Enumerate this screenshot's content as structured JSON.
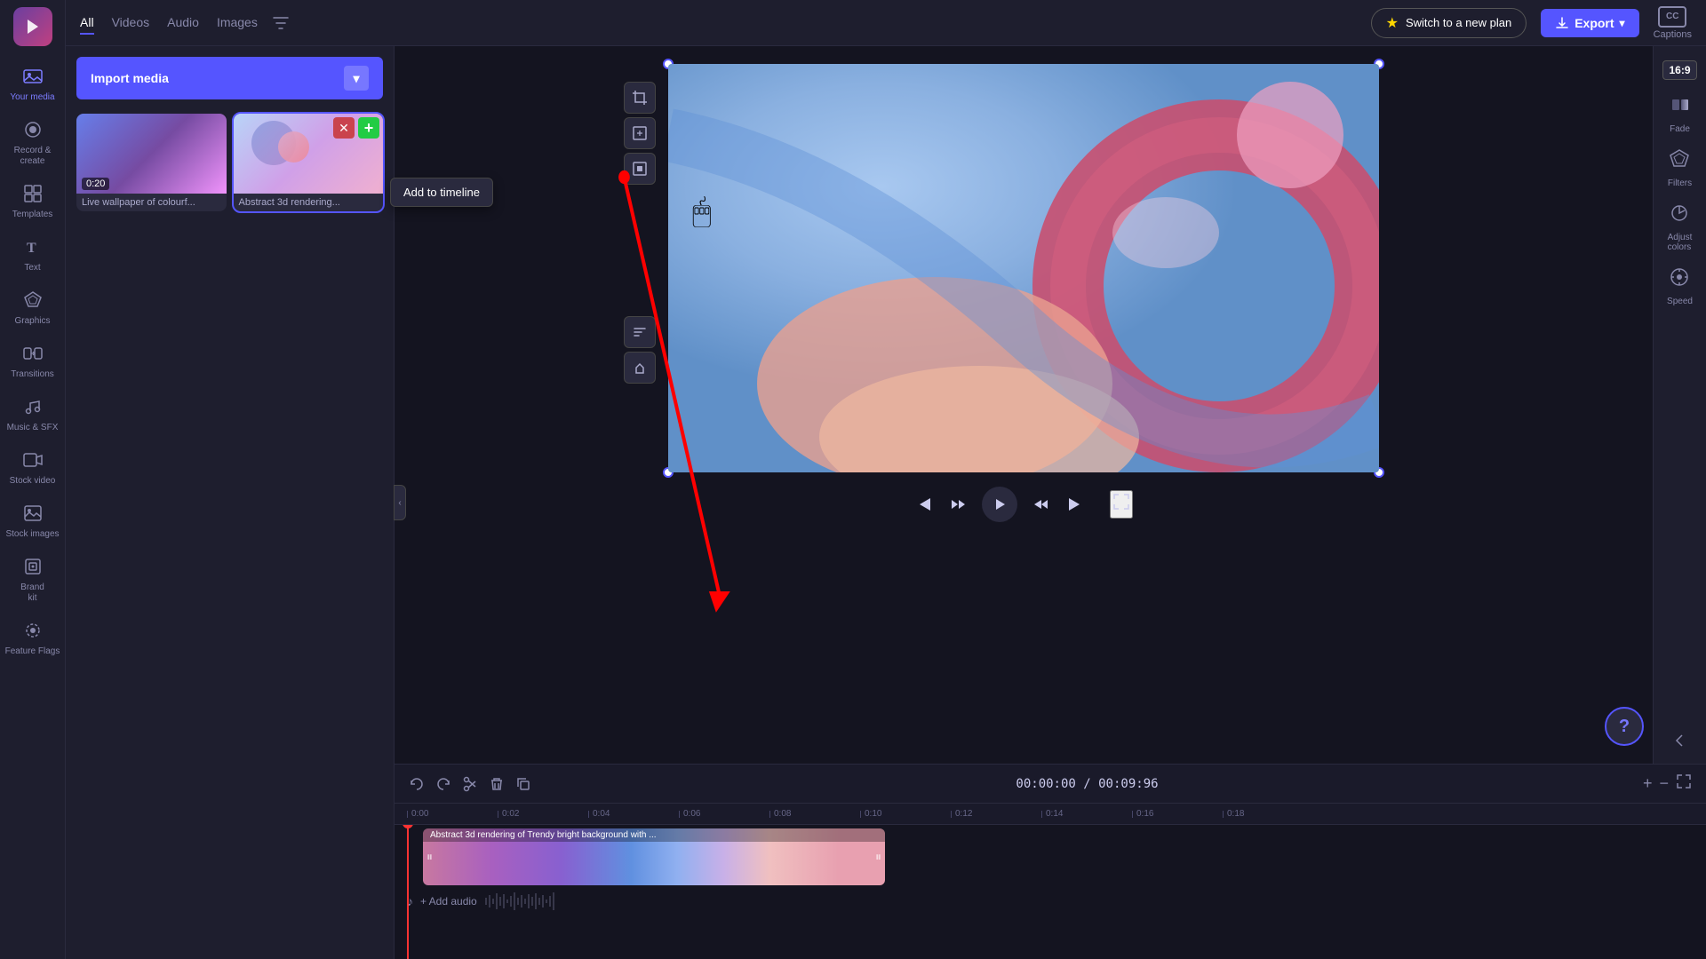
{
  "app": {
    "logo_alt": "Clipchamp logo"
  },
  "topbar": {
    "tabs": [
      {
        "label": "All",
        "active": true
      },
      {
        "label": "Videos",
        "active": false
      },
      {
        "label": "Audio",
        "active": false
      },
      {
        "label": "Images",
        "active": false
      }
    ],
    "filter_icon": "filter",
    "switch_plan_label": "Switch to a new plan",
    "export_label": "Export",
    "captions_label": "Captions",
    "captions_short": "CC"
  },
  "sidebar": {
    "items": [
      {
        "id": "your-media",
        "label": "Your media",
        "icon": "🖼",
        "active": true
      },
      {
        "id": "record-create",
        "label": "Record &\ncreate",
        "icon": "⏺"
      },
      {
        "id": "templates",
        "label": "Templates",
        "icon": "▦"
      },
      {
        "id": "text",
        "label": "Text",
        "icon": "T"
      },
      {
        "id": "graphics",
        "label": "Graphics",
        "icon": "✦"
      },
      {
        "id": "transitions",
        "label": "Transitions",
        "icon": "⇄"
      },
      {
        "id": "music-sfx",
        "label": "Music & SFX",
        "icon": "♪"
      },
      {
        "id": "stock-video",
        "label": "Stock video",
        "icon": "🎬"
      },
      {
        "id": "stock-images",
        "label": "Stock images",
        "icon": "🏞"
      },
      {
        "id": "brand-kit",
        "label": "Brand kit",
        "icon": "◈"
      },
      {
        "id": "feature-flags",
        "label": "Feature Flags",
        "icon": "⚑"
      }
    ]
  },
  "media_panel": {
    "import_label": "Import media",
    "items": [
      {
        "id": 1,
        "label": "Live wallpaper of colourf...",
        "duration": "0:20",
        "thumb_type": "gradient1"
      },
      {
        "id": 2,
        "label": "Abstract 3d rendering...",
        "duration": null,
        "thumb_type": "gradient2",
        "selected": true
      }
    ]
  },
  "add_timeline_tooltip": "Add to timeline",
  "preview": {
    "aspect_ratio": "16:9",
    "time_current": "00:00:00",
    "time_total": "00:09:96",
    "time_display": "00:00:00 / 00:09:96"
  },
  "right_panel": {
    "items": [
      {
        "id": "fade",
        "label": "Fade",
        "icon": "◑"
      },
      {
        "id": "filters",
        "label": "Filters",
        "icon": "⬡"
      },
      {
        "id": "adjust-colors",
        "label": "Adjust colors",
        "icon": "☀"
      },
      {
        "id": "speed",
        "label": "Speed",
        "icon": "⊙"
      }
    ]
  },
  "timeline": {
    "ruler_marks": [
      "0:00",
      "0:02",
      "0:04",
      "0:06",
      "0:08",
      "0:10",
      "0:12",
      "0:14",
      "0:16",
      "0:18"
    ],
    "clip_label": "Abstract 3d rendering of Trendy bright background with ...",
    "add_audio_label": "+ Add audio"
  }
}
